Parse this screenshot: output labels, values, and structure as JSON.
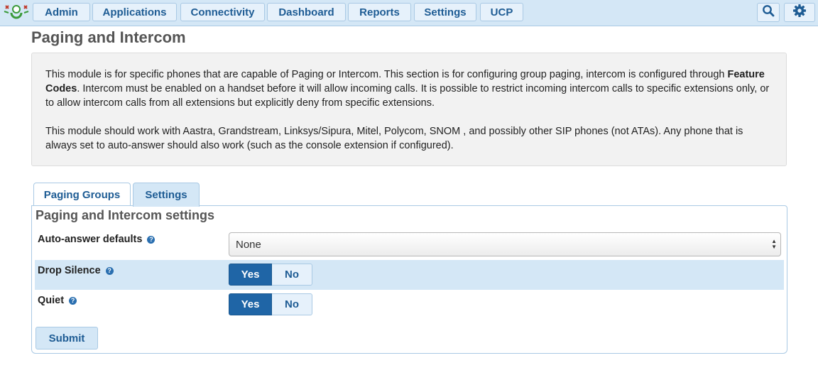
{
  "nav": {
    "items": [
      {
        "label": "Admin"
      },
      {
        "label": "Applications"
      },
      {
        "label": "Connectivity"
      },
      {
        "label": "Dashboard"
      },
      {
        "label": "Reports"
      },
      {
        "label": "Settings"
      },
      {
        "label": "UCP"
      }
    ],
    "icons": [
      "search-icon",
      "gear-icon"
    ]
  },
  "page": {
    "title": "Paging and Intercom",
    "info": {
      "p1_before": "This module is for specific phones that are capable of Paging or Intercom. This section is for configuring group paging, intercom is configured through ",
      "p1_bold": "Feature Codes",
      "p1_after": ". Intercom must be enabled on a handset before it will allow incoming calls. It is possible to restrict incoming intercom calls to specific extensions only, or to allow intercom calls from all extensions but explicitly deny from specific extensions.",
      "p2": "This module should work with Aastra, Grandstream, Linksys/Sipura, Mitel, Polycom, SNOM , and possibly other SIP phones (not ATAs). Any phone that is always set to auto-answer should also work (such as the console extension if configured)."
    }
  },
  "tabs": [
    {
      "label": "Paging Groups",
      "active": false
    },
    {
      "label": "Settings",
      "active": true
    }
  ],
  "settings": {
    "title": "Paging and Intercom settings",
    "auto_answer": {
      "label": "Auto-answer defaults",
      "value": "None"
    },
    "drop_silence": {
      "label": "Drop Silence",
      "yes": "Yes",
      "no": "No",
      "selected": "Yes"
    },
    "quiet": {
      "label": "Quiet",
      "yes": "Yes",
      "no": "No",
      "selected": "Yes"
    },
    "help_glyph": "?",
    "submit_label": "Submit"
  },
  "colors": {
    "nav_bg": "#d4e7f6",
    "accent": "#1f65a6",
    "link": "#1e5c94"
  }
}
